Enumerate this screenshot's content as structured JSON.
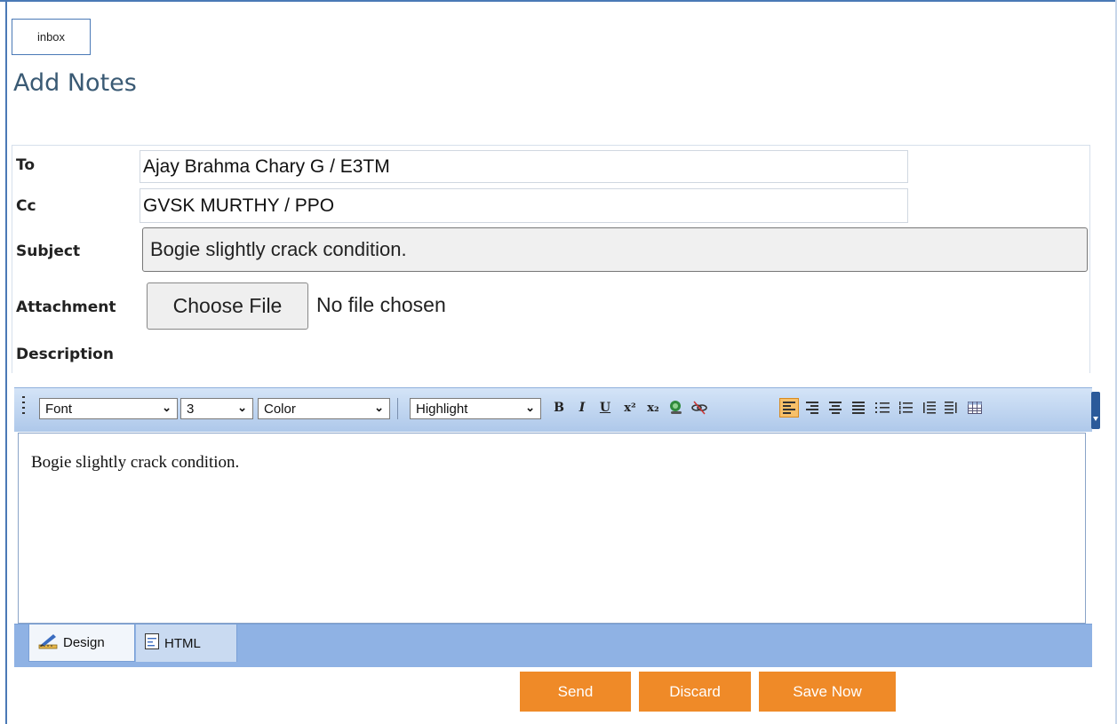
{
  "inbox": {
    "label": "inbox"
  },
  "page": {
    "title": "Add Notes"
  },
  "form": {
    "to_label": "To",
    "to_value": "Ajay Brahma Chary G / E3TM",
    "cc_label": "Cc",
    "cc_value": "GVSK MURTHY / PPO",
    "subject_label": "Subject",
    "subject_value": "Bogie slightly crack condition.",
    "attachment_label": "Attachment",
    "file_button": "Choose File",
    "file_status": "No file chosen",
    "description_label": "Description"
  },
  "toolbar": {
    "font": "Font",
    "size": "3",
    "color": "Color",
    "highlight": "Highlight",
    "bold": "B",
    "italic": "I",
    "underline": "U",
    "superscript": "x²",
    "subscript": "x₂",
    "chevron": "⌄",
    "icons": [
      "grip-icon",
      "font-select",
      "size-select",
      "color-select",
      "highlight-select",
      "bold-icon",
      "italic-icon",
      "underline-icon",
      "superscript-icon",
      "subscript-icon",
      "link-icon",
      "unlink-icon",
      "align-left-icon",
      "align-right-icon",
      "align-center-icon",
      "justify-icon",
      "bulleted-list-icon",
      "numbered-list-icon",
      "outdent-icon",
      "indent-icon",
      "table-icon",
      "toolbar-more-icon"
    ]
  },
  "editor": {
    "content": "Bogie slightly crack condition."
  },
  "modes": {
    "design": "Design",
    "html": "HTML"
  },
  "actions": {
    "send": "Send",
    "discard": "Discard",
    "save": "Save Now"
  },
  "colors": {
    "accent": "#ef8a28",
    "frame": "#4a79b6",
    "toolbar": "#aec8ea",
    "modebar": "#8fb2e4"
  }
}
